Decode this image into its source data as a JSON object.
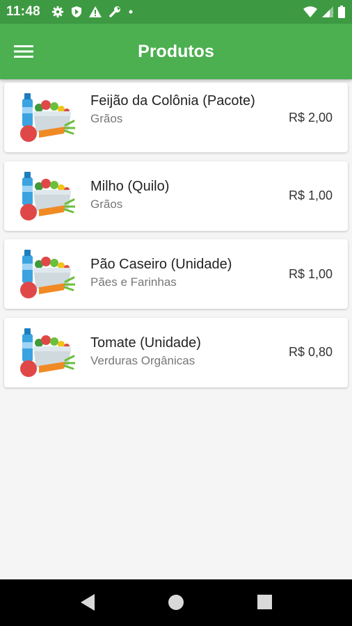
{
  "status_bar": {
    "time": "11:48",
    "icons_left": [
      "gear-icon",
      "shield-icon",
      "warning-icon",
      "wrench-icon",
      "dot-icon"
    ],
    "icons_right": [
      "wifi-icon",
      "signal-icon",
      "battery-icon"
    ]
  },
  "app_bar": {
    "title": "Produtos",
    "menu_icon": "hamburger-menu-icon",
    "color": "#4caf50"
  },
  "products": [
    {
      "title": "Feijão da Colônia (Pacote)",
      "category": "Grãos",
      "price": "R$ 2,00",
      "image": "vegetables-basket-icon"
    },
    {
      "title": "Milho (Quilo)",
      "category": "Grãos",
      "price": "R$ 1,00",
      "image": "vegetables-basket-icon"
    },
    {
      "title": "Pão Caseiro (Unidade)",
      "category": "Pães e Farinhas",
      "price": "R$ 1,00",
      "image": "vegetables-basket-icon"
    },
    {
      "title": "Tomate (Unidade)",
      "category": "Verduras Orgânicas",
      "price": "R$ 0,80",
      "image": "vegetables-basket-icon"
    }
  ],
  "nav_bar": {
    "icons": [
      "back-icon",
      "home-icon",
      "recents-icon"
    ]
  }
}
